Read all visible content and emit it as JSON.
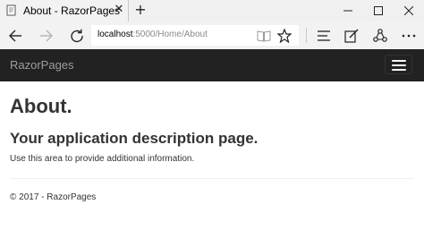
{
  "browser": {
    "tab_title": "About - RazorPages",
    "tab_close": "✕",
    "new_tab": "+",
    "url_host": "localhost",
    "url_path": ":5000/Home/About"
  },
  "app": {
    "brand": "RazorPages"
  },
  "page": {
    "heading": "About.",
    "subheading": "Your application description page.",
    "body_text": "Use this area to provide additional information.",
    "footer": "© 2017 - RazorPages"
  },
  "colors": {
    "navbar_bg": "#222222",
    "brand_text": "#9d9d9d",
    "text": "#333333"
  }
}
